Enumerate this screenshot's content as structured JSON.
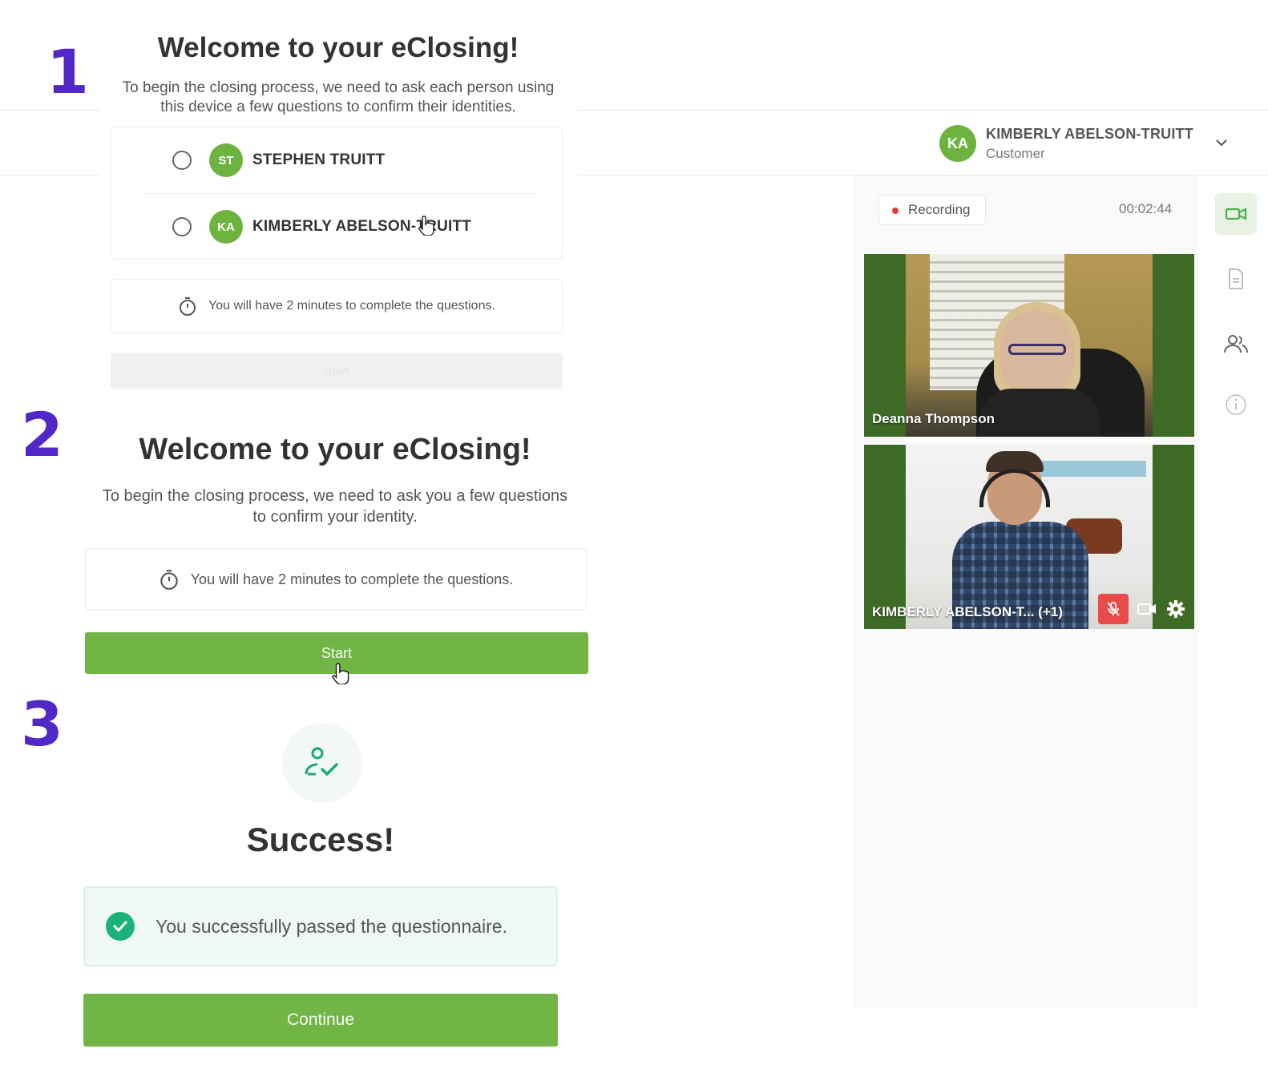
{
  "header": {
    "user_initials": "KA",
    "user_name": "KIMBERLY ABELSON-TRUITT",
    "user_role": "Customer"
  },
  "session": {
    "recording_label": "Recording",
    "timer": "00:02:44"
  },
  "videos": [
    {
      "name": "Deanna Thompson"
    },
    {
      "name": "KIMBERLY ABELSON-T...  (+1)"
    }
  ],
  "side_rail": [
    "video-icon",
    "document-icon",
    "participants-icon",
    "info-icon"
  ],
  "steps": {
    "one": "1",
    "two": "2",
    "three": "3"
  },
  "step1": {
    "title": "Welcome to your eClosing!",
    "subtitle": "To begin the closing process, we need to ask each person using this device a few questions to confirm their identities.",
    "people": [
      {
        "initials": "ST",
        "name": "STEPHEN TRUITT"
      },
      {
        "initials": "KA",
        "name": "KIMBERLY ABELSON-TRUITT"
      }
    ],
    "time_notice": "You will have 2 minutes to complete the questions.",
    "start_label": "Start"
  },
  "step2": {
    "title": "Welcome to your eClosing!",
    "subtitle": "To begin the closing process, we need to ask you a few questions to confirm your identity.",
    "time_notice": "You will have 2 minutes to complete the questions.",
    "start_label": "Start"
  },
  "step3": {
    "title": "Success!",
    "message": "You successfully passed the questionnaire.",
    "continue_label": "Continue"
  },
  "colors": {
    "brand_green": "#72b547",
    "avatar_green": "#6db33f",
    "step_number": "#5128c7",
    "success_teal": "#19b27a",
    "mute_red": "#e94a4a"
  }
}
